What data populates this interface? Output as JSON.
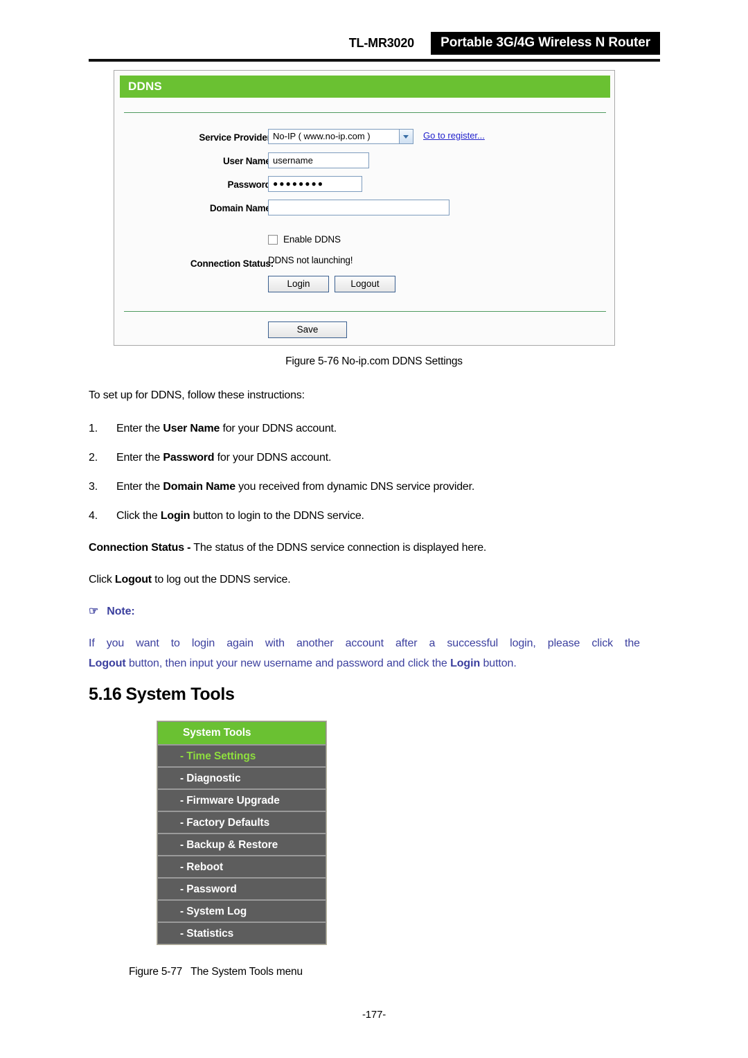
{
  "header": {
    "model": "TL-MR3020",
    "product": "Portable 3G/4G Wireless N Router"
  },
  "ddns_panel": {
    "title": "DDNS",
    "fields": {
      "service_provider_label": "Service Provider:",
      "service_provider_value": "No-IP ( www.no-ip.com )",
      "register_link": "Go to register...",
      "user_name_label": "User Name:",
      "user_name_value": "username",
      "password_label": "Password:",
      "password_value": "●●●●●●●●",
      "domain_name_label": "Domain Name:",
      "domain_name_value": ""
    },
    "enable_checkbox_label": "Enable DDNS",
    "connection_status_label": "Connection Status:",
    "connection_status_value": "DDNS not launching!",
    "buttons": {
      "login": "Login",
      "logout": "Logout",
      "save": "Save"
    },
    "accent_green": "#6ac132",
    "link_color": "#2222cc"
  },
  "captions": {
    "figure_576": "Figure 5-76 No-ip.com DDNS Settings",
    "figure_577": "Figure 5-77   The System Tools menu"
  },
  "body": {
    "intro": "To set up for DDNS, follow these instructions:",
    "steps": [
      {
        "num": "1.",
        "pre": "Enter the ",
        "bold": "User Name",
        "post": " for your DDNS account."
      },
      {
        "num": "2.",
        "pre": "Enter the ",
        "bold": "Password",
        "post": " for your DDNS account."
      },
      {
        "num": "3.",
        "pre": "Enter the ",
        "bold": "Domain Name",
        "post": " you received from dynamic DNS service provider."
      },
      {
        "num": "4.",
        "pre": "Click the ",
        "bold": "Login",
        "post": " button to login to the DDNS service."
      }
    ],
    "status_para_bold": "Connection Status -",
    "status_para_rest": " The status of the DDNS service connection is displayed here.",
    "logout_para_pre": "Click ",
    "logout_para_bold": "Logout",
    "logout_para_post": " to log out the DDNS service."
  },
  "note": {
    "icon": "☞",
    "title": "Note:",
    "line1": "If you want to login again with another account after a successful login, please click the",
    "line2_bold": "Logout",
    "line2_mid": " button, then input your new username and password and click the ",
    "line2_bold2": "Login",
    "line2_end": " button.",
    "color": "#3b3f9e"
  },
  "section": {
    "number": "5.16",
    "title": "System Tools"
  },
  "system_tools_menu": {
    "header": "System Tools",
    "active_index": 0,
    "items": [
      {
        "label": "- Time Settings",
        "active": true
      },
      {
        "label": "- Diagnostic",
        "active": false
      },
      {
        "label": "- Firmware Upgrade",
        "active": false
      },
      {
        "label": "- Factory Defaults",
        "active": false
      },
      {
        "label": "- Backup & Restore",
        "active": false
      },
      {
        "label": "- Reboot",
        "active": false
      },
      {
        "label": "- Password",
        "active": false
      },
      {
        "label": "- System Log",
        "active": false
      },
      {
        "label": "- Statistics",
        "active": false
      }
    ],
    "header_color": "#6ac132",
    "item_color": "#5d5d5d",
    "active_text_color": "#8ede3e"
  },
  "footer": {
    "page_number": "-177-"
  }
}
